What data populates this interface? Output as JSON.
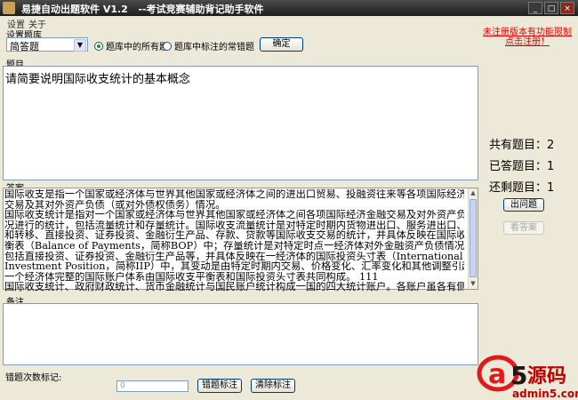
{
  "window": {
    "title": "易捷自动出题软件 V1.2   --考试竞赛辅助背记助手软件"
  },
  "menu": [
    "设置",
    "关于"
  ],
  "settings": {
    "group_label": "设置题库",
    "type_value": "简答题",
    "radio_all": "题库中的所有题",
    "radio_marked": "题库中标注的常错题",
    "confirm_label": "确定"
  },
  "question": {
    "label": "题目",
    "text": "请简要说明国际收支统计的基本概念"
  },
  "answer": {
    "label": "答案",
    "lines": [
      "国际收支是指一个国家或经济体与世界其他国家或经济体之间的进出口贸易、投融资往来等各项国际经济金融",
      "交易及其对外资产负债（或对外债权债务）情况。",
      "国际收支统计是指对一个国家或经济体与世界其他国家或经济体之间各项国际经济金融交易及对外资产负债情",
      "况进行的统计，包括流量统计和存量统计。国际收支流量统计是对特定时期内货物进出口、服务进出口、收益",
      "和转移、直接投资、证券投资、金融衍生产品、存款、贷款等国际收支交易的统计，并具体反映在国际收支平",
      "衡表（Balance of Payments，简称BOP）中；存量统计是对特定时点一经济体对外金融资产负债情况的统计，",
      "包括直接投资、证券投资、金融衍生产品等，并具体反映在一经济体的国际投资头寸表（International",
      "Investment Position，简称IIP）中，其变动是由特定时期内交易、价格变化、汇率变化和其他调整引起的。",
      "一个经济体完整的国际账户体系由国际收支平衡表和国际投资头寸表共同构成。  111",
      "国际收支统计、政府财政统计、货币金融统计与国民账户统计构成一国的四大统计账户。各账户虽各有侧重，"
    ]
  },
  "note": {
    "label": "备注"
  },
  "bottom": {
    "error_count_label": "错题次数标记:",
    "error_count_value": "0",
    "mark_label": "错题标注",
    "clear_label": "清除标注"
  },
  "side": {
    "register_link": "未注册版本有功能限制 点击注册！",
    "total_label": "共有题目：",
    "total_value": "2",
    "answered_label": "已答题目：",
    "answered_value": "1",
    "remaining_label": "还剩题目：",
    "remaining_value": "1",
    "next_label": "出问题",
    "show_answer_label": "看答案"
  },
  "watermark": {
    "text": "a5源码",
    "domain": "admin5.com"
  },
  "colors": {
    "titlebar": "#2a2a2a",
    "window_bg": "#ece9d8",
    "link_red": "#e00000",
    "field_border": "#7f9db9"
  }
}
